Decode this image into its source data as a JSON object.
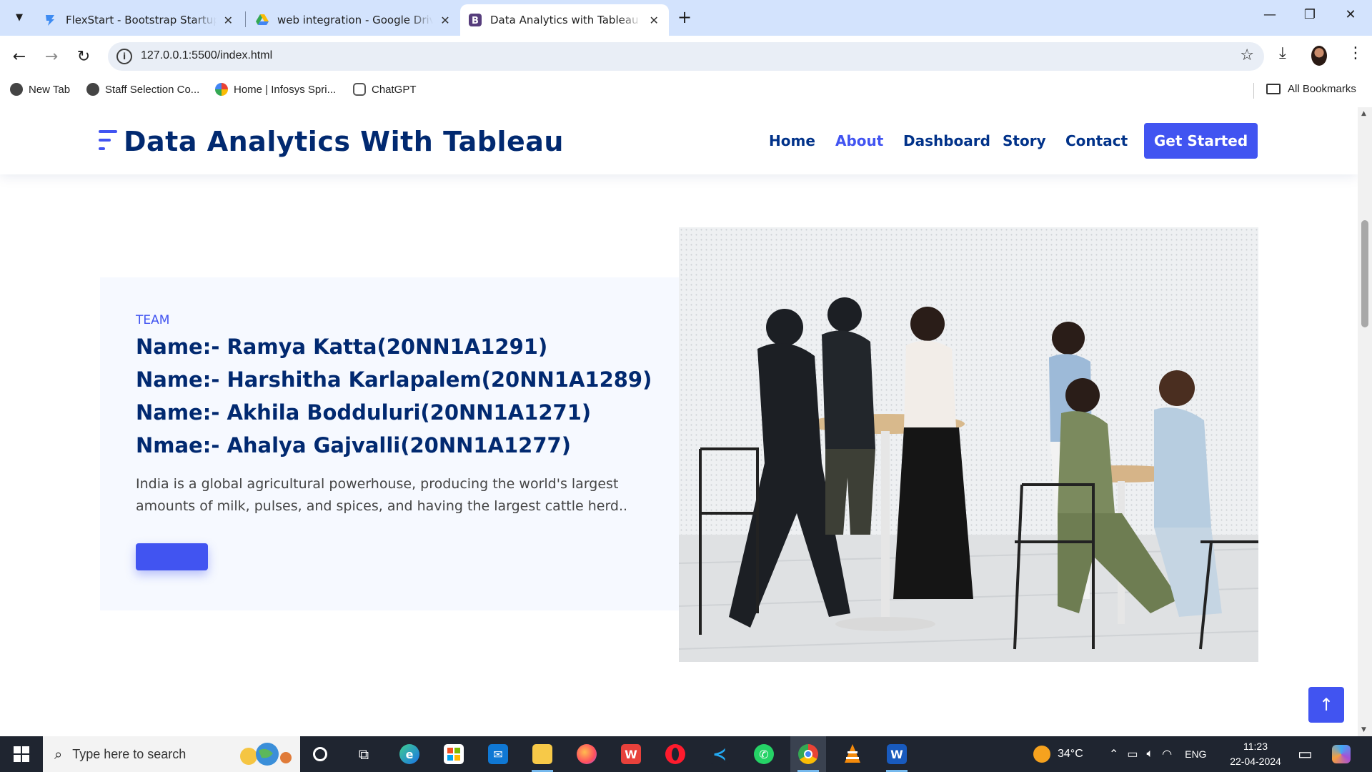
{
  "browser": {
    "tabs": [
      {
        "title": "FlexStart - Bootstrap Startup Template",
        "active": false
      },
      {
        "title": "web integration - Google Drive",
        "active": false
      },
      {
        "title": "Data Analytics with Tableau - Index",
        "active": true
      }
    ],
    "url": "127.0.0.1:5500/index.html",
    "bookmarks": [
      "New Tab",
      "Staff Selection Co...",
      "Home | Infosys Spri...",
      "ChatGPT"
    ],
    "all_bookmarks": "All Bookmarks"
  },
  "site": {
    "logo": "Data Analytics With Tableau",
    "nav": [
      "Home",
      "About",
      "Dashboard",
      "Story",
      "Contact"
    ],
    "active_nav": "About",
    "cta": "Get Started"
  },
  "about": {
    "label": "TEAM",
    "members": [
      "Name:- Ramya Katta(20NN1A1291)",
      "Name:- Harshitha Karlapalem(20NN1A1289)",
      "Name:- Akhila Bodduluri(20NN1A1271)",
      "Nmae:- Ahalya Gajvalli(20NN1A1277)"
    ],
    "description": "India is a global agricultural powerhouse, producing the world's largest amounts of milk, pulses, and spices, and having the largest cattle herd..",
    "button_label": ""
  },
  "taskbar": {
    "search_placeholder": "Type here to search",
    "weather": "34°C",
    "language": "ENG",
    "time": "11:23",
    "date": "22-04-2024",
    "apps": [
      "cortana",
      "task-view",
      "edge",
      "store",
      "mail",
      "file-explorer",
      "firefox",
      "wps-office",
      "opera",
      "vscode",
      "whatsapp",
      "chrome",
      "vlc",
      "word"
    ]
  },
  "colors": {
    "accent": "#4154f1",
    "heading": "#012970",
    "section_bg": "#f6f9ff",
    "tabstrip": "#d3e3fd",
    "taskbar": "#1f2530"
  }
}
